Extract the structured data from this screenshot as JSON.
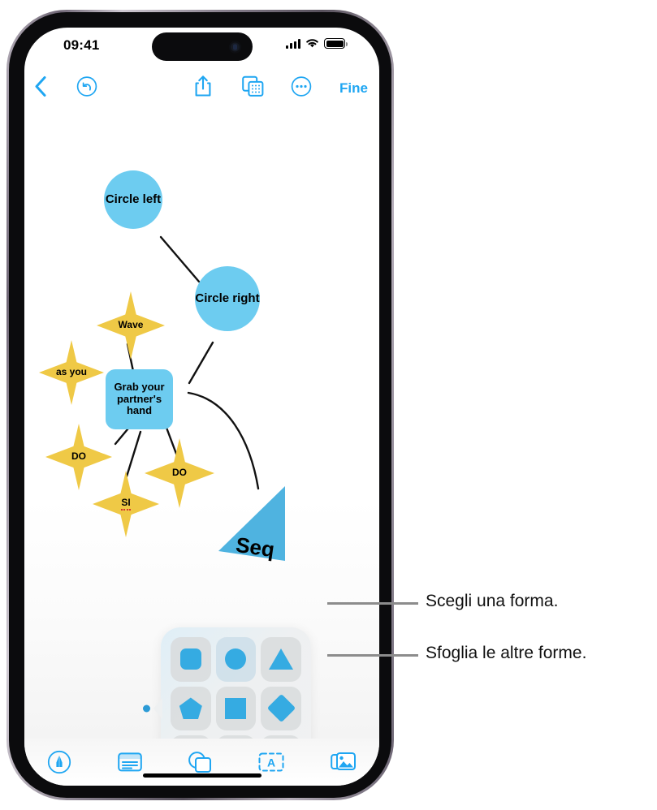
{
  "status_bar": {
    "time": "09:41",
    "cellular_icon": "cellular-bars-icon",
    "wifi_icon": "wifi-icon",
    "battery_icon": "battery-full-icon"
  },
  "nav_bar": {
    "back_icon": "chevron-left-icon",
    "undo_icon": "undo-circle-icon",
    "share_icon": "share-up-icon",
    "board_icon": "boards-icon",
    "more_icon": "ellipsis-circle-icon",
    "done_label": "Fine"
  },
  "canvas": {
    "nodes": [
      {
        "id": "circle-left",
        "label": "Circle left",
        "shape": "circle",
        "color": "#6DCCF0"
      },
      {
        "id": "circle-right",
        "label": "Circle right",
        "shape": "circle",
        "color": "#6DCCF0"
      },
      {
        "id": "wave",
        "label": "Wave",
        "shape": "star",
        "color": "#EFC946"
      },
      {
        "id": "as-you",
        "label": "as you",
        "shape": "star",
        "color": "#EFC946"
      },
      {
        "id": "grab-hand",
        "label": "Grab your partner's hand",
        "shape": "rounded-rect",
        "color": "#6DCCF0"
      },
      {
        "id": "do-left",
        "label": "DO",
        "shape": "star",
        "color": "#EFC946"
      },
      {
        "id": "do-right",
        "label": "DO",
        "shape": "star",
        "color": "#EFC946"
      },
      {
        "id": "si",
        "label": "SI",
        "shape": "star",
        "color": "#EFC946"
      },
      {
        "id": "seq",
        "label": "Seq",
        "shape": "triangle",
        "color": "#4FB3E0"
      }
    ]
  },
  "shape_popover": {
    "anchor_dot_color": "#2C9BD6",
    "shapes": [
      {
        "name": "rounded-square-shape",
        "icon": "rounded-square-icon"
      },
      {
        "name": "circle-shape",
        "icon": "circle-icon"
      },
      {
        "name": "triangle-shape",
        "icon": "triangle-icon"
      },
      {
        "name": "pentagon-shape",
        "icon": "pentagon-icon"
      },
      {
        "name": "square-shape",
        "icon": "square-icon"
      },
      {
        "name": "diamond-shape",
        "icon": "diamond-icon"
      },
      {
        "name": "pill-shape",
        "icon": "pill-icon"
      },
      {
        "name": "parallelogram-shape",
        "icon": "parallelogram-icon"
      },
      {
        "name": "more-shapes",
        "icon": "ellipsis-icon"
      }
    ]
  },
  "bottom_bar": {
    "items": [
      {
        "name": "draw-tool",
        "icon": "pen-circle-icon"
      },
      {
        "name": "note-tool",
        "icon": "note-card-icon"
      },
      {
        "name": "shape-tool",
        "icon": "shapes-overlap-icon"
      },
      {
        "name": "text-tool",
        "icon": "text-box-icon"
      },
      {
        "name": "media-tool",
        "icon": "photos-icon"
      }
    ]
  },
  "callouts": [
    {
      "text": "Scegli una forma."
    },
    {
      "text": "Sfoglia le altre forme."
    }
  ],
  "colors": {
    "accent_blue": "#1FA6F2",
    "shape_blue": "#35ABE2",
    "node_blue": "#6DCCF0",
    "node_yellow": "#EFC946",
    "callout_gray": "#8c8c8c"
  }
}
